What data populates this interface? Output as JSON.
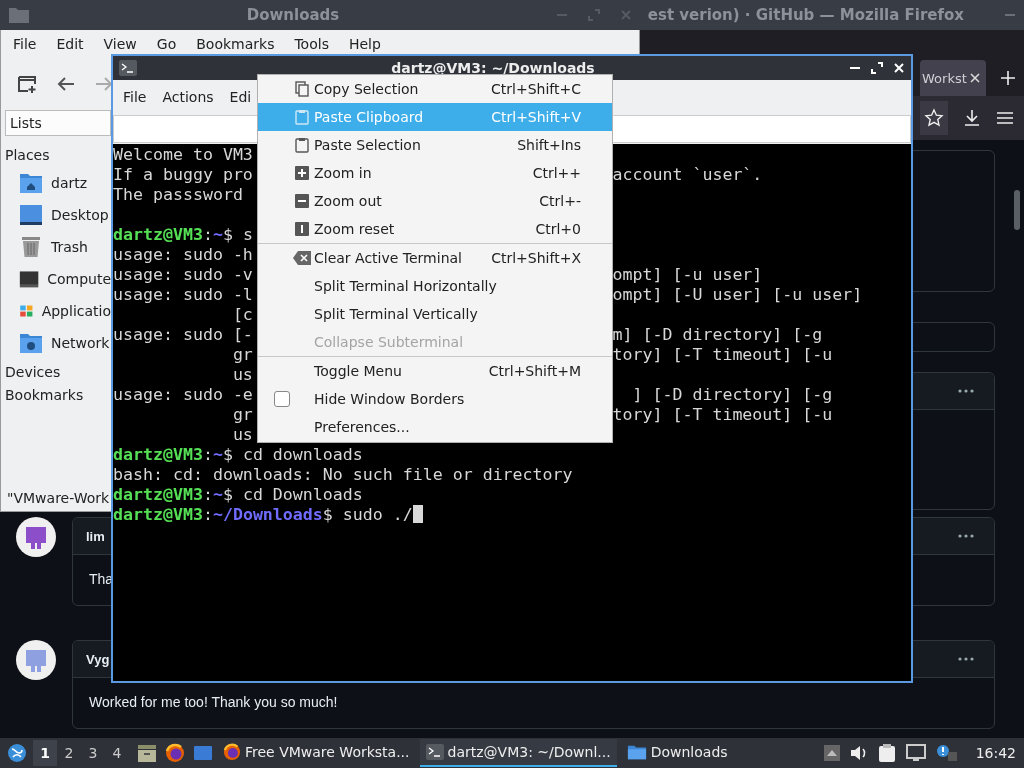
{
  "firefox": {
    "title": "est verion) · GitHub — Mozilla Firefox",
    "tab": {
      "title": "Workst"
    },
    "comments": [
      {
        "author": "lim",
        "body": "Tha",
        "color": "#8c4fc9"
      },
      {
        "author": "Vyg",
        "body": "Worked for me too! Thank you so much!",
        "color": "#8fa0e0"
      }
    ]
  },
  "file_manager": {
    "title": "Downloads",
    "menu": [
      "File",
      "Edit",
      "View",
      "Go",
      "Bookmarks",
      "Tools",
      "Help"
    ],
    "side_pane_mode": "Lists",
    "sections": [
      {
        "title": "Places",
        "items": [
          {
            "label": "dartz",
            "kind": "home"
          },
          {
            "label": "Desktop",
            "kind": "desktop"
          },
          {
            "label": "Trash",
            "kind": "trash"
          },
          {
            "label": "Compute",
            "kind": "computer"
          },
          {
            "label": "Applicatio",
            "kind": "apps"
          },
          {
            "label": "Network",
            "kind": "network"
          }
        ]
      },
      {
        "title": "Devices"
      },
      {
        "title": "Bookmarks"
      }
    ],
    "status": "\"VMware-Work"
  },
  "terminal": {
    "title": "dartz@VM3: ~/Downloads",
    "menu": [
      "File",
      "Actions",
      "Edi"
    ],
    "lines": [
      {
        "kind": "output",
        "text": "Welcome to VM3"
      },
      {
        "kind": "output",
        "text": "If a buggy pro",
        "rest": "account `user`."
      },
      {
        "kind": "output",
        "text": "The passsword"
      },
      {
        "kind": "blank"
      },
      {
        "kind": "prompt",
        "cursor": false,
        "segments": [
          {
            "kind": "user",
            "text": "dartz@VM3"
          },
          {
            "kind": "plain",
            "text": ":"
          },
          {
            "kind": "path",
            "text": "~"
          },
          {
            "kind": "plain",
            "text": "$ s"
          }
        ]
      },
      {
        "kind": "output",
        "text": "usage: sudo -h"
      },
      {
        "kind": "output",
        "text": "usage: sudo -v",
        "rest": "ompt] [-u user]"
      },
      {
        "kind": "output",
        "text": "usage: sudo -l",
        "rest": "ompt] [-U user] [-u user]"
      },
      {
        "kind": "output",
        "text": "            [c"
      },
      {
        "kind": "output",
        "text": "usage: sudo [-",
        "rest": "m] [-D directory] [-g"
      },
      {
        "kind": "output",
        "text": "            gr",
        "rest": "tory] [-T timeout] [-u"
      },
      {
        "kind": "output",
        "text": "            us"
      },
      {
        "kind": "output",
        "text": "usage: sudo -e",
        "rest": "  ] [-D directory] [-g"
      },
      {
        "kind": "output",
        "text": "            gr",
        "rest": "tory] [-T timeout] [-u"
      },
      {
        "kind": "output",
        "text": "            us"
      },
      {
        "kind": "prompt",
        "cursor": false,
        "segments": [
          {
            "kind": "user",
            "text": "dartz@VM3"
          },
          {
            "kind": "plain",
            "text": ":"
          },
          {
            "kind": "path",
            "text": "~"
          },
          {
            "kind": "plain",
            "text": "$ cd downloads"
          }
        ]
      },
      {
        "kind": "output",
        "text": "bash: cd: downloads: No such file or directory"
      },
      {
        "kind": "prompt",
        "cursor": false,
        "segments": [
          {
            "kind": "user",
            "text": "dartz@VM3"
          },
          {
            "kind": "plain",
            "text": ":"
          },
          {
            "kind": "path",
            "text": "~"
          },
          {
            "kind": "plain",
            "text": "$ cd Downloads"
          }
        ]
      },
      {
        "kind": "prompt",
        "cursor": true,
        "segments": [
          {
            "kind": "user",
            "text": "dartz@VM3"
          },
          {
            "kind": "plain",
            "text": ":"
          },
          {
            "kind": "path",
            "text": "~/Downloads"
          },
          {
            "kind": "plain",
            "text": "$ sudo ./"
          }
        ]
      }
    ],
    "context_menu": {
      "groups": [
        {
          "items": [
            {
              "kind": "copy",
              "label": "Copy Selection",
              "shortcut": "Ctrl+Shift+C",
              "selected": false,
              "disabled": false
            },
            {
              "kind": "paste",
              "label": "Paste Clipboard",
              "shortcut": "Ctrl+Shift+V",
              "selected": true,
              "disabled": false
            },
            {
              "kind": "paste",
              "label": "Paste Selection",
              "shortcut": "Shift+Ins",
              "selected": false,
              "disabled": false
            },
            {
              "kind": "zoom_in",
              "label": "Zoom in",
              "shortcut": "Ctrl++",
              "selected": false,
              "disabled": false
            },
            {
              "kind": "zoom_out",
              "label": "Zoom out",
              "shortcut": "Ctrl+-",
              "selected": false,
              "disabled": false
            },
            {
              "kind": "zoom_reset",
              "label": "Zoom reset",
              "shortcut": "Ctrl+0",
              "selected": false,
              "disabled": false
            }
          ]
        },
        {
          "items": [
            {
              "kind": "clear",
              "label": "Clear Active Terminal",
              "shortcut": "Ctrl+Shift+X",
              "selected": false,
              "disabled": false
            },
            {
              "kind": "command",
              "label": "Split Terminal Horizontally",
              "selected": false,
              "disabled": false
            },
            {
              "kind": "command",
              "label": "Split Terminal Vertically",
              "selected": false,
              "disabled": false
            },
            {
              "kind": "command",
              "label": "Collapse Subterminal",
              "selected": false,
              "disabled": true
            }
          ]
        },
        {
          "items": [
            {
              "kind": "command",
              "label": "Toggle Menu",
              "shortcut": "Ctrl+Shift+M",
              "selected": false,
              "disabled": false
            },
            {
              "kind": "checkbox",
              "label": "Hide Window Borders",
              "checked": false,
              "selected": false,
              "disabled": false
            },
            {
              "kind": "command",
              "label": "Preferences...",
              "selected": false,
              "disabled": false
            }
          ]
        }
      ]
    }
  },
  "taskbar": {
    "workspaces": [
      {
        "label": "1",
        "selected": true
      },
      {
        "label": "2",
        "selected": false
      },
      {
        "label": "3",
        "selected": false
      },
      {
        "label": "4",
        "selected": false
      }
    ],
    "tasks": [
      {
        "label": "Free VMware Worksta...",
        "kind": "firefox",
        "selected": false
      },
      {
        "label": "dartz@VM3: ~/Downl...",
        "kind": "terminal",
        "selected": true
      },
      {
        "label": "Downloads",
        "kind": "folder",
        "selected": false
      }
    ],
    "clock": "16:42"
  }
}
